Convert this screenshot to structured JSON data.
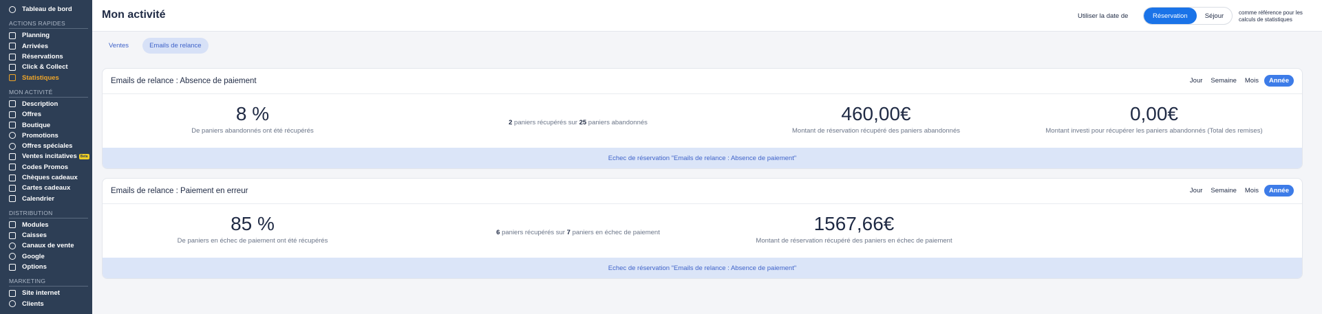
{
  "sidebar": {
    "top": {
      "label": "Tableau de bord",
      "icon": "dashboard-icon"
    },
    "sections": [
      {
        "title": "ACTIONS RAPIDES",
        "items": [
          {
            "label": "Planning",
            "icon": "planning-icon"
          },
          {
            "label": "Arrivées",
            "icon": "arrivals-icon"
          },
          {
            "label": "Réservations",
            "icon": "reservations-icon"
          },
          {
            "label": "Click & Collect",
            "icon": "click-collect-icon"
          },
          {
            "label": "Statistiques",
            "icon": "statistics-icon",
            "active": true
          }
        ]
      },
      {
        "title": "MON ACTIVITÉ",
        "items": [
          {
            "label": "Description",
            "icon": "description-icon"
          },
          {
            "label": "Offres",
            "icon": "offers-icon"
          },
          {
            "label": "Boutique",
            "icon": "shop-icon"
          },
          {
            "label": "Promotions",
            "icon": "promotions-icon"
          },
          {
            "label": "Offres spéciales",
            "icon": "special-offers-icon"
          },
          {
            "label": "Ventes incitatives",
            "icon": "upsell-icon",
            "badge": "Beta"
          },
          {
            "label": "Codes Promos",
            "icon": "promo-code-icon"
          },
          {
            "label": "Chèques cadeaux",
            "icon": "gift-voucher-icon"
          },
          {
            "label": "Cartes cadeaux",
            "icon": "gift-card-icon"
          },
          {
            "label": "Calendrier",
            "icon": "calendar-icon"
          }
        ]
      },
      {
        "title": "DISTRIBUTION",
        "items": [
          {
            "label": "Modules",
            "icon": "modules-icon"
          },
          {
            "label": "Caisses",
            "icon": "cash-register-icon"
          },
          {
            "label": "Canaux de vente",
            "icon": "sales-channels-icon"
          },
          {
            "label": "Google",
            "icon": "google-icon"
          },
          {
            "label": "Options",
            "icon": "options-icon"
          }
        ]
      },
      {
        "title": "MARKETING",
        "items": [
          {
            "label": "Site internet",
            "icon": "website-icon"
          },
          {
            "label": "Clients",
            "icon": "clients-icon"
          }
        ]
      }
    ]
  },
  "header": {
    "title": "Mon activité",
    "date_label": "Utiliser la date de",
    "toggle": {
      "option_a": "Réservation",
      "option_b": "Séjour",
      "selected": "Réservation"
    },
    "ref_text": "comme référence pour les calculs de statistiques"
  },
  "tabs": [
    {
      "label": "Ventes",
      "active": false
    },
    {
      "label": "Emails de relance",
      "active": true
    }
  ],
  "periods": {
    "day": "Jour",
    "week": "Semaine",
    "month": "Mois",
    "year": "Année",
    "selected": "Année"
  },
  "cards": [
    {
      "title": "Emails de relance : Absence de paiement",
      "stat1": {
        "value": "8 %",
        "label": "De paniers abandonnés ont été récupérés"
      },
      "stat2": {
        "recovered": "2",
        "text_a": "paniers récupérés sur",
        "total": "25",
        "text_b": "paniers abandonnés"
      },
      "stat3": {
        "value": "460,00€",
        "label": "Montant de réservation récupéré des paniers abandonnés"
      },
      "stat4": {
        "value": "0,00€",
        "label": "Montant investi pour récupérer les paniers abandonnés (Total des remises)"
      },
      "footer": "Echec de réservation \"Emails de relance : Absence de paiement\""
    },
    {
      "title": "Emails de relance : Paiement en erreur",
      "stat1": {
        "value": "85 %",
        "label": "De paniers en échec de paiement ont été récupérés"
      },
      "stat2": {
        "recovered": "6",
        "text_a": "paniers récupérés sur",
        "total": "7",
        "text_b": "paniers en échec de paiement"
      },
      "stat3": {
        "value": "1567,66€",
        "label": "Montant de réservation récupéré des paniers en échec de paiement"
      },
      "footer": "Echec de réservation \"Emails de relance : Absence de paiement\""
    }
  ],
  "colors": {
    "accent": "#1a73e8",
    "sidebar_bg": "#2d3e55",
    "active_nav": "#f0a629"
  }
}
